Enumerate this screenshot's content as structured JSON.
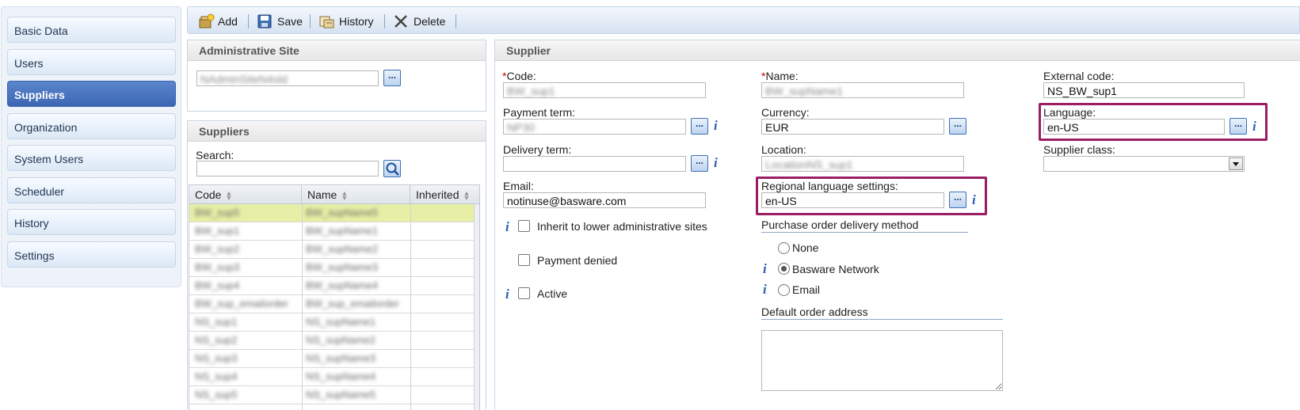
{
  "nav": {
    "items": [
      {
        "label": "Basic Data"
      },
      {
        "label": "Users"
      },
      {
        "label": "Suppliers"
      },
      {
        "label": "Organization"
      },
      {
        "label": "System Users"
      },
      {
        "label": "Scheduler"
      },
      {
        "label": "History"
      },
      {
        "label": "Settings"
      }
    ],
    "active": "Suppliers"
  },
  "toolbar": {
    "add_label": "Add",
    "save_label": "Save",
    "history_label": "History",
    "delete_label": "Delete"
  },
  "admin_site": {
    "title": "Administrative Site",
    "value": "NAdminSiteN4sld"
  },
  "suppliers_panel": {
    "title": "Suppliers",
    "search_label": "Search:",
    "search_value": "",
    "columns": [
      "Code",
      "Name",
      "Inherited"
    ],
    "rows": [
      {
        "code": "BW_sup5",
        "name": "BW_supName5",
        "inherited": ""
      },
      {
        "code": "BW_sup1",
        "name": "BW_supName1",
        "inherited": ""
      },
      {
        "code": "BW_sup2",
        "name": "BW_supName2",
        "inherited": ""
      },
      {
        "code": "BW_sup3",
        "name": "BW_supName3",
        "inherited": ""
      },
      {
        "code": "BW_sup4",
        "name": "BW_supName4",
        "inherited": ""
      },
      {
        "code": "BW_sup_emailorder",
        "name": "BW_sup_emailorder",
        "inherited": ""
      },
      {
        "code": "NS_sup1",
        "name": "NS_supName1",
        "inherited": ""
      },
      {
        "code": "NS_sup2",
        "name": "NS_supName2",
        "inherited": ""
      },
      {
        "code": "NS_sup3",
        "name": "NS_supName3",
        "inherited": ""
      },
      {
        "code": "NS_sup4",
        "name": "NS_supName4",
        "inherited": ""
      },
      {
        "code": "NS_sup5",
        "name": "NS_supName5",
        "inherited": ""
      }
    ]
  },
  "supplier": {
    "title": "Supplier",
    "required_mark": "*",
    "code_label": "Code:",
    "code_value": "BW_sup1",
    "name_label": "Name:",
    "name_value": "BW_supName1",
    "external_code_label": "External code:",
    "external_code_value": "NS_BW_sup1",
    "payment_term_label": "Payment term:",
    "payment_term_value": "NP30",
    "currency_label": "Currency:",
    "currency_value": "EUR",
    "language_label": "Language:",
    "language_value": "en-US",
    "delivery_term_label": "Delivery term:",
    "delivery_term_value": "",
    "location_label": "Location:",
    "location_value": "LocationNS_sup1",
    "supplier_class_label": "Supplier class:",
    "supplier_class_value": "",
    "email_label": "Email:",
    "email_value": "notinuse@basware.com",
    "regional_label": "Regional language settings:",
    "regional_value": "en-US",
    "inherit_label": "Inherit to lower administrative sites",
    "payment_denied_label": "Payment denied",
    "active_label": "Active",
    "po_method_label": "Purchase order delivery method",
    "po_options": [
      "None",
      "Basware Network",
      "Email"
    ],
    "po_selected": "Basware Network",
    "default_address_label": "Default order address",
    "default_address_value": ""
  },
  "colors": {
    "accent": "#3c66b3",
    "highlight": "#9b1d63",
    "selected_row": "#e7efa6"
  }
}
